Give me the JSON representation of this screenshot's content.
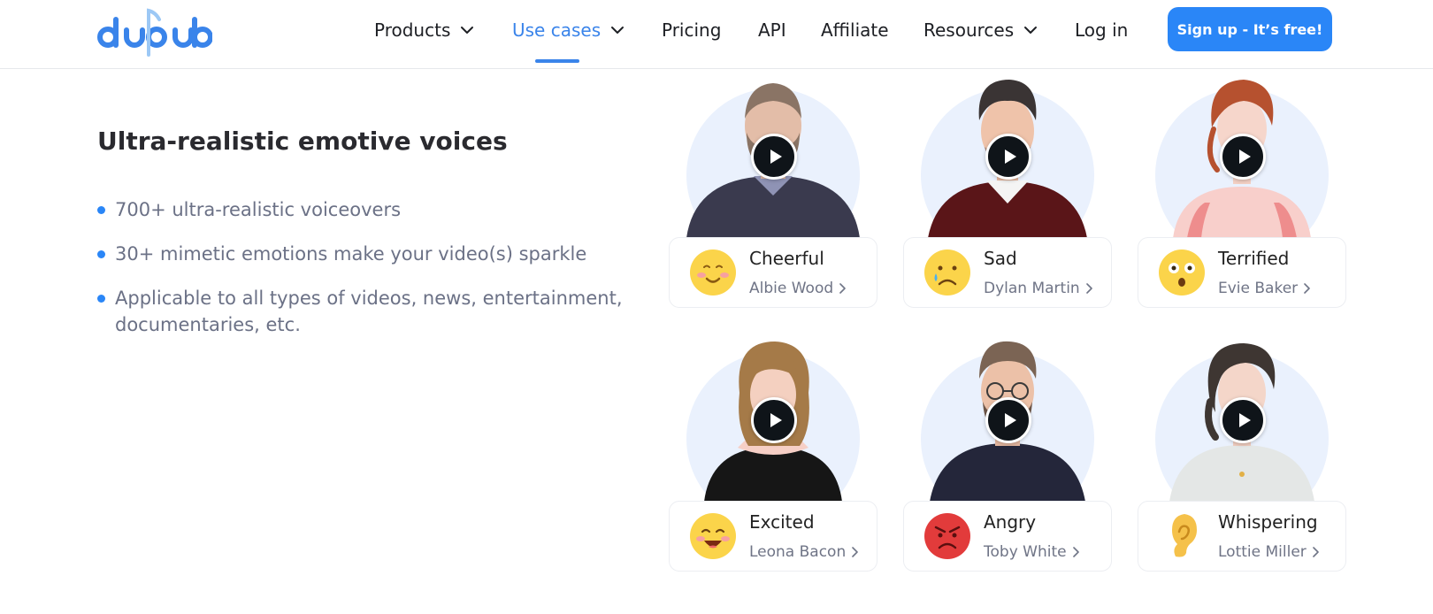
{
  "brand": {
    "name": "dupdub",
    "logo_icon": "dupdub-logo",
    "accent": "#2a86f7"
  },
  "nav": {
    "items": [
      {
        "label": "Products",
        "dropdown": true,
        "active": false
      },
      {
        "label": "Use cases",
        "dropdown": true,
        "active": true
      },
      {
        "label": "Pricing",
        "dropdown": false,
        "active": false
      },
      {
        "label": "API",
        "dropdown": false,
        "active": false
      },
      {
        "label": "Affiliate",
        "dropdown": false,
        "active": false
      },
      {
        "label": "Resources",
        "dropdown": true,
        "active": false
      },
      {
        "label": "Log in",
        "dropdown": false,
        "active": false
      }
    ],
    "signup_label": "Sign up - It’s free!"
  },
  "section": {
    "title": "Ultra-realistic emotive voices",
    "features": [
      "700+ ultra-realistic voiceovers",
      "30+ mimetic emotions make your video(s) sparkle",
      "Applicable to all types of videos, news, entertainment, documentaries, etc."
    ]
  },
  "voices": [
    {
      "emotion": "Cheerful",
      "speaker": "Albie Wood",
      "emoji_icon": "cheerful-emoji",
      "avatar": "avatar-albie-wood"
    },
    {
      "emotion": "Sad",
      "speaker": "Dylan Martin",
      "emoji_icon": "sad-emoji",
      "avatar": "avatar-dylan-martin"
    },
    {
      "emotion": "Terrified",
      "speaker": "Evie Baker",
      "emoji_icon": "terrified-emoji",
      "avatar": "avatar-evie-baker"
    },
    {
      "emotion": "Excited",
      "speaker": "Leona Bacon",
      "emoji_icon": "excited-emoji",
      "avatar": "avatar-leona-bacon"
    },
    {
      "emotion": "Angry",
      "speaker": "Toby White",
      "emoji_icon": "angry-emoji",
      "avatar": "avatar-toby-white"
    },
    {
      "emotion": "Whispering",
      "speaker": "Lottie Miller",
      "emoji_icon": "ear-emoji",
      "avatar": "avatar-lottie-miller"
    }
  ]
}
